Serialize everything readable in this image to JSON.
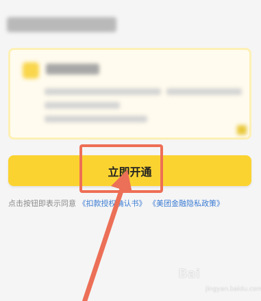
{
  "main": {
    "open_button_label": "立即开通"
  },
  "agreement": {
    "prefix": "点击按钮即表示同意",
    "link1": "《扣款授权确认书》",
    "link2": "《美团金融隐私政策》"
  },
  "watermark": {
    "text": "Bai",
    "sub_text": "jingyan.baidu.com"
  },
  "colors": {
    "button": "#fbd331",
    "highlight": "#ee6e55",
    "link": "#3b7bd3",
    "card_bg": "#fffbee"
  }
}
